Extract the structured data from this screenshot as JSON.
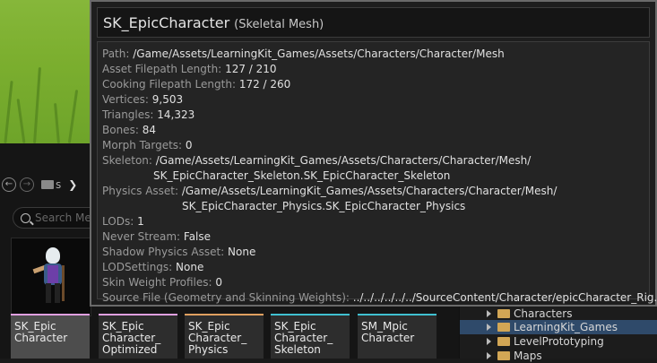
{
  "tooltip": {
    "asset_name": "SK_EpicCharacter",
    "asset_type": "(Skeletal Mesh)",
    "rows": {
      "path": {
        "label": "Path:",
        "value": "/Game/Assets/LearningKit_Games/Assets/Characters/Character/Mesh"
      },
      "asset_filepath_length": {
        "label": "Asset Filepath Length:",
        "value": "127 / 210"
      },
      "cooking_filepath_length": {
        "label": "Cooking Filepath Length:",
        "value": "172 / 260"
      },
      "vertices": {
        "label": "Vertices:",
        "value": "9,503"
      },
      "triangles": {
        "label": "Triangles:",
        "value": "14,323"
      },
      "bones": {
        "label": "Bones:",
        "value": "84"
      },
      "morph_targets": {
        "label": "Morph Targets:",
        "value": "0"
      },
      "skeleton": {
        "label": "Skeleton:",
        "value": "/Game/Assets/LearningKit_Games/Assets/Characters/Character/Mesh/",
        "value2": "SK_EpicCharacter_Skeleton.SK_EpicCharacter_Skeleton"
      },
      "physics_asset": {
        "label": "Physics Asset:",
        "value": "/Game/Assets/LearningKit_Games/Assets/Characters/Character/Mesh/",
        "value2": "SK_EpicCharacter_Physics.SK_EpicCharacter_Physics"
      },
      "lods": {
        "label": "LODs:",
        "value": "1"
      },
      "never_stream": {
        "label": "Never Stream:",
        "value": "False"
      },
      "shadow_physics_asset": {
        "label": "Shadow Physics Asset:",
        "value": "None"
      },
      "lod_settings": {
        "label": "LODSettings:",
        "value": "None"
      },
      "skin_weight_profiles": {
        "label": "Skin Weight Profiles:",
        "value": "0"
      },
      "source_file": {
        "label": "Source File (Geometry and Skinning Weights):",
        "value": "../../../../../../SourceContent/Character/epicCharacter_Rig.fbx"
      }
    }
  },
  "content_browser": {
    "breadcrumb_text": "s",
    "search_placeholder": "Search Me",
    "assets": [
      {
        "line1": "SK_Epic",
        "line2": "Character",
        "color": "#e0a0e0"
      },
      {
        "line1": "SK_Epic",
        "line2": "Character_",
        "line3": "Optimized",
        "color": "#e0a0e0"
      },
      {
        "line1": "SK_Epic",
        "line2": "Character_",
        "line3": "Physics",
        "color": "#e0a060"
      },
      {
        "line1": "SK_Epic",
        "line2": "Character_",
        "line3": "Skeleton",
        "color": "#40c0d0"
      },
      {
        "line1": "SM_Mpic",
        "line2": "Character",
        "color": "#40c0d0"
      }
    ]
  },
  "folder_tree": {
    "items": [
      {
        "label": "Characters"
      },
      {
        "label": "LearningKit_Games",
        "selected": true
      },
      {
        "label": "LevelPrototyping"
      },
      {
        "label": "Maps"
      }
    ]
  }
}
